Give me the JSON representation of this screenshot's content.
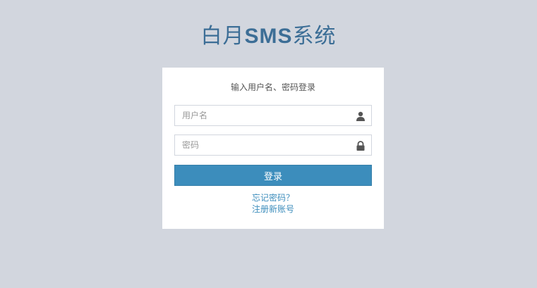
{
  "logo": {
    "prefix": "白月",
    "bold": "SMS",
    "suffix": "系统"
  },
  "login_box": {
    "message": "输入用户名、密码登录",
    "username": {
      "placeholder": "用户名",
      "value": "",
      "icon": "user-icon"
    },
    "password": {
      "placeholder": "密码",
      "value": "",
      "icon": "lock-icon"
    },
    "submit_label": "登录",
    "forgot_password_link": "忘记密码？",
    "register_link": "注册新账号"
  },
  "colors": {
    "background": "#d2d6de",
    "brand": "#3c6e96",
    "button": "#3c8dbc",
    "link": "#3c8dbc"
  }
}
